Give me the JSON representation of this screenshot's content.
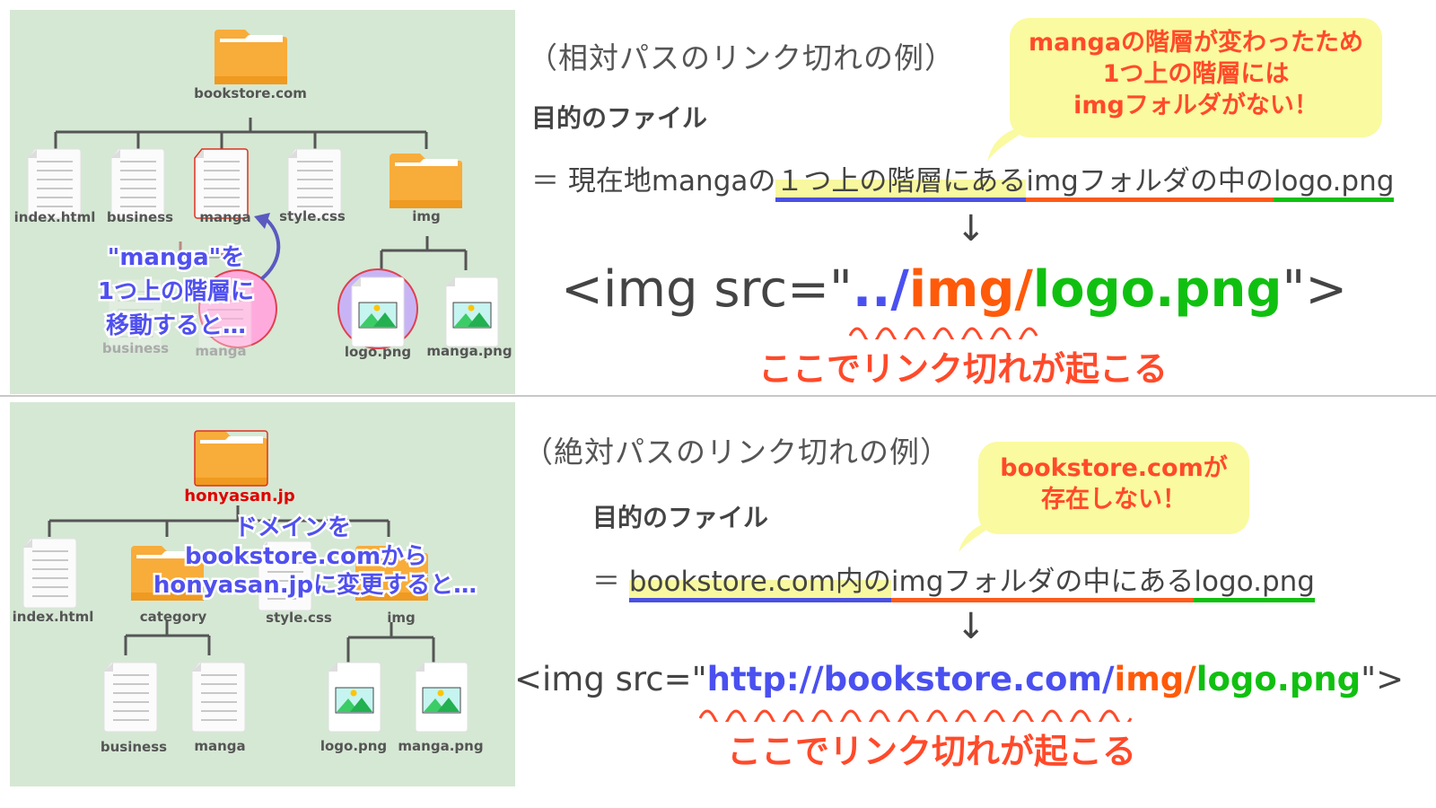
{
  "panel1": {
    "root_label": "bookstore.com",
    "children": [
      "index.html",
      "business",
      "manga",
      "style.css",
      "img"
    ],
    "img_children": [
      "logo.png",
      "manga.png"
    ],
    "faded_labels": [
      "business",
      "manga"
    ],
    "overlay_lines": [
      "\"manga\"を",
      "1つ上の階層に",
      "移動すると…"
    ]
  },
  "panel2": {
    "root_label": "honyasan.jp",
    "children": [
      "index.html",
      "category",
      "style.css",
      "img"
    ],
    "category_children": [
      "business",
      "manga"
    ],
    "img_children": [
      "logo.png",
      "manga.png"
    ],
    "overlay_lines": [
      "ドメインを",
      "bookstore.comから",
      "honyasan.jpに変更すると…"
    ]
  },
  "section1": {
    "heading": "（相対パスのリンク切れの例）",
    "target_label": "目的のファイル",
    "eq_prefix": "＝ 現在地mangaの",
    "eq_part_blue": "１つ上の階層にある",
    "eq_part_orange": "imgフォルダの中の",
    "eq_part_green": "logo.png",
    "arrow": "↓",
    "code_prefix": "<img src=\"",
    "code_blue": "../",
    "code_orange": "img/",
    "code_green": "logo.png",
    "code_suffix": "\">",
    "warning": "ここでリンク切れが起こる",
    "bubble_lines": [
      "mangaの階層が変わったため",
      "1つ上の階層には",
      "imgフォルダがない！"
    ]
  },
  "section2": {
    "heading": "（絶対パスのリンク切れの例）",
    "target_label": "目的のファイル",
    "eq_prefix": "＝ ",
    "eq_part_blue": "bookstore.com内の",
    "eq_part_orange": "imgフォルダの中にある",
    "eq_part_green": "logo.png",
    "arrow": "↓",
    "code_prefix": "<img src=\"",
    "code_blue": "http://bookstore.com/",
    "code_orange": "img/",
    "code_green": "logo.png",
    "code_suffix": "\">",
    "warning": "ここでリンク切れが起こる",
    "bubble_lines": [
      "bookstore.comが",
      "存在しない！"
    ]
  },
  "colors": {
    "panel_bg": "#d5e8d4",
    "folder": "#f8ac3a",
    "blue": "#4a50f0",
    "orange": "#ff5a0a",
    "green": "#10c010",
    "warning": "#ff4a2a",
    "bubble": "#fafaa0"
  }
}
